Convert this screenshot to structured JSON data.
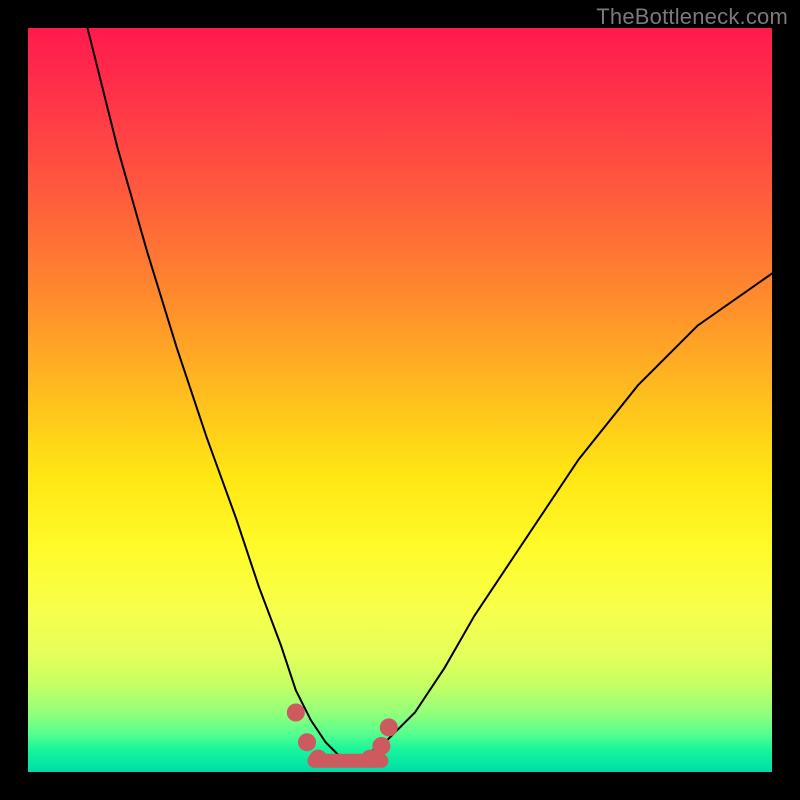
{
  "watermark": "TheBottleneck.com",
  "colors": {
    "marker": "#cc5a5f",
    "curve": "#000000"
  },
  "chart_data": {
    "type": "line",
    "title": "",
    "xlabel": "",
    "ylabel": "",
    "xlim": [
      0,
      100
    ],
    "ylim": [
      0,
      100
    ],
    "grid": false,
    "legend": false,
    "note": "No axis ticks or numeric labels are rendered; values below are positional estimates on a 0–100 normalized scale derived from pixel geometry.",
    "series": [
      {
        "name": "bottleneck-curve",
        "x": [
          8,
          12,
          16,
          20,
          24,
          28,
          31,
          34,
          36,
          38,
          40,
          42,
          45,
          48,
          52,
          56,
          60,
          66,
          74,
          82,
          90,
          100
        ],
        "y": [
          100,
          84,
          70,
          57,
          45,
          34,
          25,
          17,
          11,
          7,
          4,
          2,
          2,
          4,
          8,
          14,
          21,
          30,
          42,
          52,
          60,
          67
        ]
      },
      {
        "name": "optimal-flat-region",
        "x": [
          38.5,
          47.5
        ],
        "y": [
          1.5,
          1.5
        ]
      }
    ],
    "markers": [
      {
        "x": 36.0,
        "y": 8.0
      },
      {
        "x": 37.5,
        "y": 4.0
      },
      {
        "x": 39.0,
        "y": 1.8
      },
      {
        "x": 46.0,
        "y": 1.8
      },
      {
        "x": 47.5,
        "y": 3.5
      },
      {
        "x": 48.5,
        "y": 6.0
      }
    ]
  }
}
